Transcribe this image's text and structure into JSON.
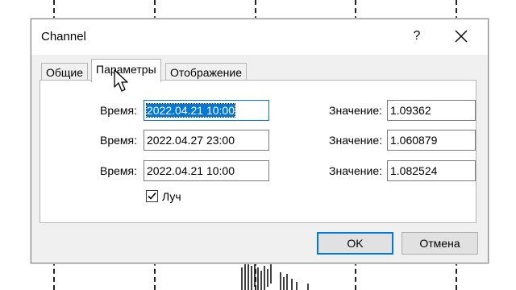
{
  "window": {
    "title": "Channel",
    "help": "?"
  },
  "tabs": [
    {
      "label": "Общие",
      "active": false
    },
    {
      "label": "Параметры",
      "active": true
    },
    {
      "label": "Отображение",
      "active": false
    }
  ],
  "params": {
    "time_label": "Время:",
    "value_label": "Значение:",
    "rows": [
      {
        "time": "2022.04.21 10:00",
        "value": "1.09362"
      },
      {
        "time": "2022.04.27 23:00",
        "value": "1.060879"
      },
      {
        "time": "2022.04.21 10:00",
        "value": "1.082524"
      }
    ],
    "ray_label": "Луч",
    "ray_checked": true
  },
  "buttons": {
    "ok": "OK",
    "cancel": "Отмена"
  },
  "colors": {
    "focus": "#0078d7",
    "dialog_bg": "#f0f0f0"
  },
  "icons": [
    "close-icon",
    "checkmark-icon",
    "mouse-pointer-icon"
  ]
}
